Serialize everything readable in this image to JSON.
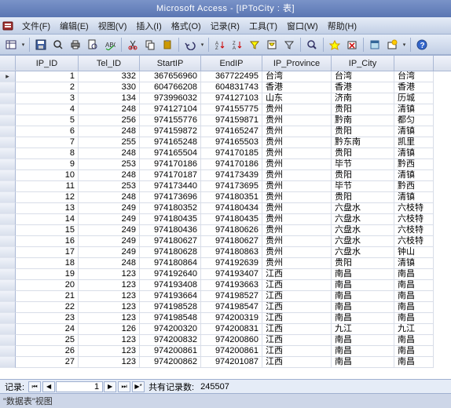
{
  "title": "Microsoft Access - [IPToCity : 表]",
  "menus": [
    "文件(F)",
    "编辑(E)",
    "视图(V)",
    "插入(I)",
    "格式(O)",
    "记录(R)",
    "工具(T)",
    "窗口(W)",
    "帮助(H)"
  ],
  "columns": [
    "IP_ID",
    "Tel_ID",
    "StartIP",
    "EndIP",
    "IP_Province",
    "IP_City",
    ""
  ],
  "rows": [
    {
      "id": 1,
      "tel": 332,
      "start": 367656960,
      "end": 367722495,
      "prov": "台湾",
      "city": "台湾",
      "c7": "台湾"
    },
    {
      "id": 2,
      "tel": 330,
      "start": 604766208,
      "end": 604831743,
      "prov": "香港",
      "city": "香港",
      "c7": "香港"
    },
    {
      "id": 3,
      "tel": 134,
      "start": 973996032,
      "end": 974127103,
      "prov": "山东",
      "city": "济南",
      "c7": "历城"
    },
    {
      "id": 4,
      "tel": 248,
      "start": 974127104,
      "end": 974155775,
      "prov": "贵州",
      "city": "贵阳",
      "c7": "清镇"
    },
    {
      "id": 5,
      "tel": 256,
      "start": 974155776,
      "end": 974159871,
      "prov": "贵州",
      "city": "黔南",
      "c7": "都匀"
    },
    {
      "id": 6,
      "tel": 248,
      "start": 974159872,
      "end": 974165247,
      "prov": "贵州",
      "city": "贵阳",
      "c7": "清镇"
    },
    {
      "id": 7,
      "tel": 255,
      "start": 974165248,
      "end": 974165503,
      "prov": "贵州",
      "city": "黔东南",
      "c7": "凯里"
    },
    {
      "id": 8,
      "tel": 248,
      "start": 974165504,
      "end": 974170185,
      "prov": "贵州",
      "city": "贵阳",
      "c7": "清镇"
    },
    {
      "id": 9,
      "tel": 253,
      "start": 974170186,
      "end": 974170186,
      "prov": "贵州",
      "city": "毕节",
      "c7": "黔西"
    },
    {
      "id": 10,
      "tel": 248,
      "start": 974170187,
      "end": 974173439,
      "prov": "贵州",
      "city": "贵阳",
      "c7": "清镇"
    },
    {
      "id": 11,
      "tel": 253,
      "start": 974173440,
      "end": 974173695,
      "prov": "贵州",
      "city": "毕节",
      "c7": "黔西"
    },
    {
      "id": 12,
      "tel": 248,
      "start": 974173696,
      "end": 974180351,
      "prov": "贵州",
      "city": "贵阳",
      "c7": "清镇"
    },
    {
      "id": 13,
      "tel": 249,
      "start": 974180352,
      "end": 974180434,
      "prov": "贵州",
      "city": "六盘水",
      "c7": "六枝特"
    },
    {
      "id": 14,
      "tel": 249,
      "start": 974180435,
      "end": 974180435,
      "prov": "贵州",
      "city": "六盘水",
      "c7": "六枝特"
    },
    {
      "id": 15,
      "tel": 249,
      "start": 974180436,
      "end": 974180626,
      "prov": "贵州",
      "city": "六盘水",
      "c7": "六枝特"
    },
    {
      "id": 16,
      "tel": 249,
      "start": 974180627,
      "end": 974180627,
      "prov": "贵州",
      "city": "六盘水",
      "c7": "六枝特"
    },
    {
      "id": 17,
      "tel": 249,
      "start": 974180628,
      "end": 974180863,
      "prov": "贵州",
      "city": "六盘水",
      "c7": "钟山"
    },
    {
      "id": 18,
      "tel": 248,
      "start": 974180864,
      "end": 974192639,
      "prov": "贵州",
      "city": "贵阳",
      "c7": "清镇"
    },
    {
      "id": 19,
      "tel": 123,
      "start": 974192640,
      "end": 974193407,
      "prov": "江西",
      "city": "南昌",
      "c7": "南昌"
    },
    {
      "id": 20,
      "tel": 123,
      "start": 974193408,
      "end": 974193663,
      "prov": "江西",
      "city": "南昌",
      "c7": "南昌"
    },
    {
      "id": 21,
      "tel": 123,
      "start": 974193664,
      "end": 974198527,
      "prov": "江西",
      "city": "南昌",
      "c7": "南昌"
    },
    {
      "id": 22,
      "tel": 123,
      "start": 974198528,
      "end": 974198547,
      "prov": "江西",
      "city": "南昌",
      "c7": "南昌"
    },
    {
      "id": 23,
      "tel": 123,
      "start": 974198548,
      "end": 974200319,
      "prov": "江西",
      "city": "南昌",
      "c7": "南昌"
    },
    {
      "id": 24,
      "tel": 126,
      "start": 974200320,
      "end": 974200831,
      "prov": "江西",
      "city": "九江",
      "c7": "九江"
    },
    {
      "id": 25,
      "tel": 123,
      "start": 974200832,
      "end": 974200860,
      "prov": "江西",
      "city": "南昌",
      "c7": "南昌"
    },
    {
      "id": 26,
      "tel": 123,
      "start": 974200861,
      "end": 974200861,
      "prov": "江西",
      "city": "南昌",
      "c7": "南昌"
    },
    {
      "id": 27,
      "tel": 123,
      "start": 974200862,
      "end": 974201087,
      "prov": "江西",
      "city": "南昌",
      "c7": "南昌"
    }
  ],
  "nav": {
    "label": "记录:",
    "current": "1",
    "total_label": "共有记录数:",
    "total": "245507"
  },
  "status": "\"数据表\"视图"
}
